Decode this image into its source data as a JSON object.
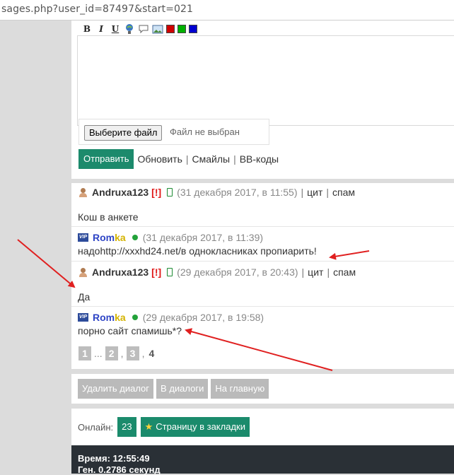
{
  "browser": {
    "url": "sages.php?user_id=87497&start=021"
  },
  "toolbar": {
    "bold": "B",
    "italic": "I",
    "underline": "U",
    "colors": [
      "#d00000",
      "#00b000",
      "#0000d0"
    ]
  },
  "composer": {
    "file_button": "Выберите файл",
    "file_status": "Файл не выбран",
    "send": "Отправить",
    "refresh": "Обновить",
    "smiles": "Смайлы",
    "bbcodes": "BB-коды",
    "sep": "|"
  },
  "messages": [
    {
      "user": "Andruxa123",
      "flag": "[!]",
      "date": "(31 декабря 2017, в 11:55)",
      "cit": "цит",
      "spam": "спам",
      "text": "Кош в анкете"
    },
    {
      "vip": "VIP",
      "user_a": "Rom",
      "user_b": "ka",
      "date": "(31 декабря 2017, в 11:39)",
      "text_a": "надо ",
      "link": "http://xxxhd24.net/",
      "text_b": " в однокласниках пропиарить!"
    },
    {
      "user": "Andruxa123",
      "flag": "[!]",
      "date": "(29 декабря 2017, в 20:43)",
      "cit": "цит",
      "spam": "спам",
      "text": "Да"
    },
    {
      "vip": "VIP",
      "user_a": "Rom",
      "user_b": "ka",
      "date": "(29 декабря 2017, в 19:58)",
      "text": "порно сайт спамишь*?"
    }
  ],
  "pager": {
    "p1": "1",
    "dots": "...",
    "p2": "2",
    "comma": ",",
    "p3": "3",
    "current": "4"
  },
  "dialog_actions": {
    "delete": "Удалить диалог",
    "in_dialogs": "В диалоги",
    "home": "На главную"
  },
  "online": {
    "label": "Онлайн:",
    "count": "23",
    "bookmark": "Страницу в закладки"
  },
  "footer": {
    "time": "Время: 12:55:49",
    "gen": "Ген. 0.2786 секунд"
  },
  "colors": {
    "accent": "#1c8a6c",
    "arrow": "#e02020",
    "romka_blue": "#2f45c6",
    "romka_gold": "#d4b300"
  }
}
